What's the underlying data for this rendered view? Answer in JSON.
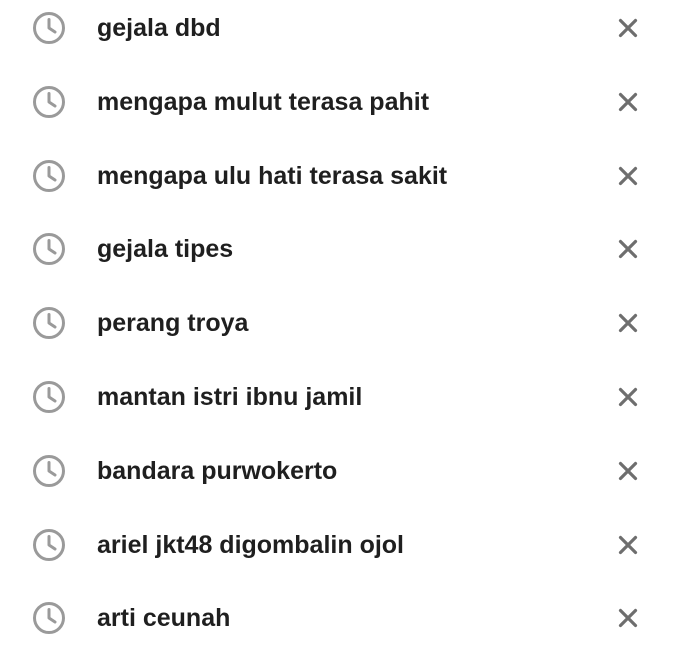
{
  "history": {
    "items": [
      {
        "label": "gejala dbd",
        "icon": "clock-icon",
        "remove_icon": "close-icon"
      },
      {
        "label": "mengapa mulut terasa pahit",
        "icon": "clock-icon",
        "remove_icon": "close-icon"
      },
      {
        "label": "mengapa ulu hati terasa sakit",
        "icon": "clock-icon",
        "remove_icon": "close-icon"
      },
      {
        "label": "gejala tipes",
        "icon": "clock-icon",
        "remove_icon": "close-icon"
      },
      {
        "label": "perang troya",
        "icon": "clock-icon",
        "remove_icon": "close-icon"
      },
      {
        "label": "mantan istri ibnu jamil",
        "icon": "clock-icon",
        "remove_icon": "close-icon"
      },
      {
        "label": "bandara purwokerto",
        "icon": "clock-icon",
        "remove_icon": "close-icon"
      },
      {
        "label": "ariel jkt48 digombalin ojol",
        "icon": "clock-icon",
        "remove_icon": "close-icon"
      },
      {
        "label": "arti ceunah",
        "icon": "clock-icon",
        "remove_icon": "close-icon"
      }
    ]
  },
  "colors": {
    "text": "#1f1f1f",
    "icon": "#9a9a9a",
    "remove_icon": "#6e6e6e",
    "background": "#ffffff"
  }
}
